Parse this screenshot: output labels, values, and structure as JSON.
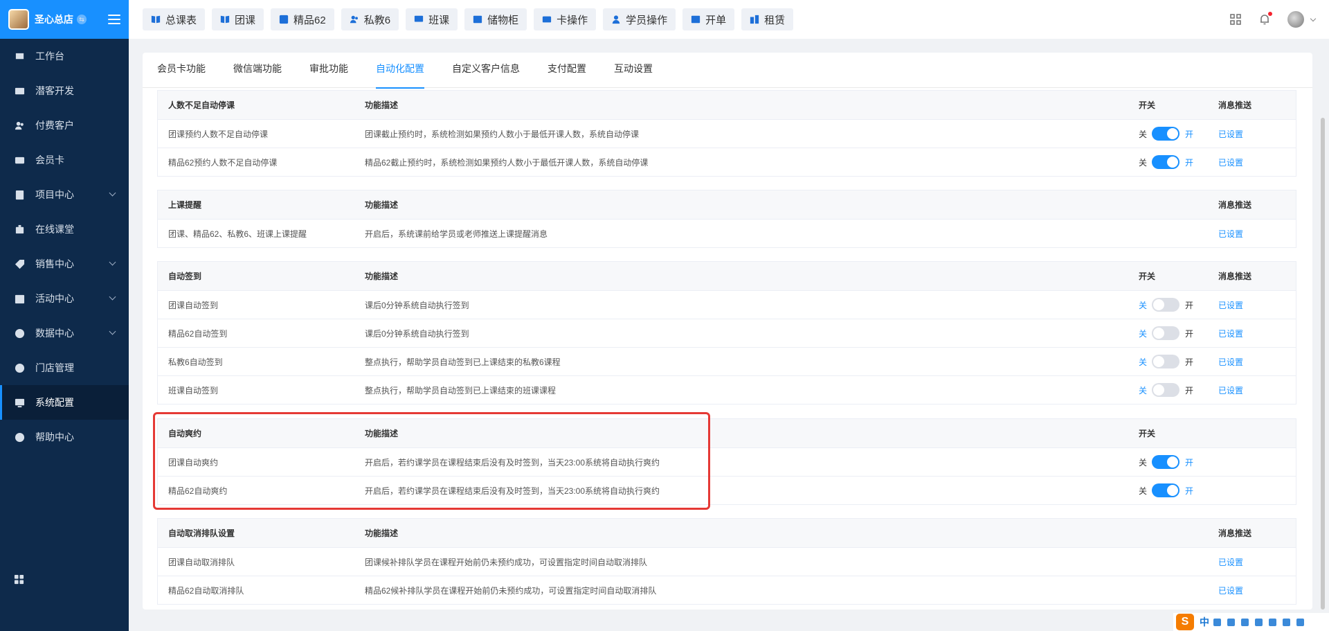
{
  "brand": {
    "name": "圣心总店",
    "badge": "⇆"
  },
  "sidebar": {
    "items": [
      {
        "label": "工作台",
        "icon": "dashboard-icon",
        "chevron": false,
        "active": false
      },
      {
        "label": "潜客开发",
        "icon": "id-card-icon",
        "chevron": false,
        "active": false
      },
      {
        "label": "付费客户",
        "icon": "users-icon",
        "chevron": false,
        "active": false
      },
      {
        "label": "会员卡",
        "icon": "card-icon",
        "chevron": false,
        "active": false
      },
      {
        "label": "项目中心",
        "icon": "project-icon",
        "chevron": true,
        "active": false
      },
      {
        "label": "在线课堂",
        "icon": "classroom-icon",
        "chevron": false,
        "active": false
      },
      {
        "label": "销售中心",
        "icon": "tag-icon",
        "chevron": true,
        "active": false
      },
      {
        "label": "活动中心",
        "icon": "activity-icon",
        "chevron": true,
        "active": false
      },
      {
        "label": "数据中心",
        "icon": "pie-chart-icon",
        "chevron": true,
        "active": false
      },
      {
        "label": "门店管理",
        "icon": "store-icon",
        "chevron": false,
        "active": false
      },
      {
        "label": "系统配置",
        "icon": "settings-icon",
        "chevron": false,
        "active": true
      },
      {
        "label": "帮助中心",
        "icon": "help-icon",
        "chevron": false,
        "active": false
      }
    ]
  },
  "topbar": {
    "tabs": [
      {
        "label": "总课表",
        "icon": "book-icon"
      },
      {
        "label": "团课",
        "icon": "book-icon"
      },
      {
        "label": "精品62",
        "icon": "star-card-icon"
      },
      {
        "label": "私教6",
        "icon": "users-icon"
      },
      {
        "label": "班课",
        "icon": "board-icon"
      },
      {
        "label": "储物柜",
        "icon": "locker-icon"
      },
      {
        "label": "卡操作",
        "icon": "card-icon"
      },
      {
        "label": "学员操作",
        "icon": "user-icon"
      },
      {
        "label": "开单",
        "icon": "order-icon"
      },
      {
        "label": "租赁",
        "icon": "rent-icon"
      }
    ]
  },
  "tabs": [
    {
      "label": "会员卡功能",
      "active": false
    },
    {
      "label": "微信端功能",
      "active": false
    },
    {
      "label": "审批功能",
      "active": false
    },
    {
      "label": "自动化配置",
      "active": true
    },
    {
      "label": "自定义客户信息",
      "active": false
    },
    {
      "label": "支付配置",
      "active": false
    },
    {
      "label": "互动设置",
      "active": false
    }
  ],
  "switch_labels": {
    "off": "关",
    "on": "开"
  },
  "sections": [
    {
      "headers": [
        "人数不足自动停课",
        "功能描述",
        "开关",
        "消息推送"
      ],
      "rows": [
        {
          "name": "团课预约人数不足自动停课",
          "desc": "团课截止预约时，系统检测如果预约人数小于最低开课人数，系统自动停课",
          "switch": "on",
          "push": "已设置"
        },
        {
          "name": "精品62预约人数不足自动停课",
          "desc": "精品62截止预约时，系统检测如果预约人数小于最低开课人数，系统自动停课",
          "switch": "on",
          "push": "已设置"
        }
      ]
    },
    {
      "headers": [
        "上课提醒",
        "功能描述",
        "",
        "消息推送"
      ],
      "rows": [
        {
          "name": "团课、精品62、私教6、班课上课提醒",
          "desc": "开启后，系统课前给学员或老师推送上课提醒消息",
          "switch": null,
          "push": "已设置"
        }
      ]
    },
    {
      "headers": [
        "自动签到",
        "功能描述",
        "开关",
        "消息推送"
      ],
      "rows": [
        {
          "name": "团课自动签到",
          "desc": "课后0分钟系统自动执行签到",
          "switch": "off",
          "push": "已设置"
        },
        {
          "name": "精品62自动签到",
          "desc": "课后0分钟系统自动执行签到",
          "switch": "off",
          "push": "已设置"
        },
        {
          "name": "私教6自动签到",
          "desc": "整点执行，帮助学员自动签到已上课结束的私教6课程",
          "switch": "off",
          "push": "已设置"
        },
        {
          "name": "班课自动签到",
          "desc": "整点执行，帮助学员自动签到已上课结束的班课课程",
          "switch": "off",
          "push": "已设置"
        }
      ]
    },
    {
      "headers": [
        "自动爽约",
        "功能描述",
        "开关",
        ""
      ],
      "rows": [
        {
          "name": "团课自动爽约",
          "desc": "开启后，若约课学员在课程结束后没有及时签到，当天23:00系统将自动执行爽约",
          "switch": "on",
          "push": null
        },
        {
          "name": "精品62自动爽约",
          "desc": "开启后，若约课学员在课程结束后没有及时签到，当天23:00系统将自动执行爽约",
          "switch": "on",
          "push": null
        }
      ]
    },
    {
      "headers": [
        "自动取消排队设置",
        "功能描述",
        "",
        "消息推送"
      ],
      "rows": [
        {
          "name": "团课自动取消排队",
          "desc": "团课候补排队学员在课程开始前仍未预约成功，可设置指定时间自动取消排队",
          "switch": null,
          "push": "已设置"
        },
        {
          "name": "精品62自动取消排队",
          "desc": "精品62候补排队学员在课程开始前仍未预约成功，可设置指定时间自动取消排队",
          "switch": null,
          "push": "已设置"
        }
      ]
    }
  ],
  "ime": {
    "logo": "S",
    "lang": "中"
  },
  "colors": {
    "accent": "#1890ff",
    "sidebar": "#0e2a4b",
    "highlight": "#e53935"
  }
}
